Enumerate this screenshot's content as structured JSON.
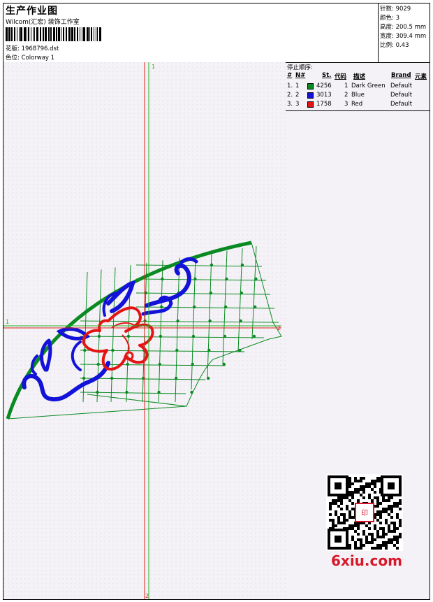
{
  "header": {
    "title": "生产作业图",
    "company": "Wilcom(汇宏) 装饰工作室",
    "design_label": "花版: 1968796.dst",
    "color_label": "色位: Colorway 1"
  },
  "stats": [
    "针数: 9029",
    "颜色: 3",
    "高度: 200.5 mm",
    "宽度: 309.4 mm",
    "比例: 0.43"
  ],
  "stop_sequence": {
    "title": "停止顺序:",
    "columns": [
      "#",
      "N#",
      "St.",
      "代码",
      "描述",
      "Brand",
      "元素"
    ],
    "rows": [
      {
        "idx": "1.",
        "n": "1",
        "stitches": "4256",
        "code": "1",
        "desc": "Dark Green",
        "brand": "Default",
        "color": "#0a8a22"
      },
      {
        "idx": "2.",
        "n": "2",
        "stitches": "3013",
        "code": "2",
        "desc": "Blue",
        "brand": "Default",
        "color": "#1212d8"
      },
      {
        "idx": "3.",
        "n": "3",
        "stitches": "1758",
        "code": "3",
        "desc": "Red",
        "brand": "Default",
        "color": "#e41414"
      }
    ]
  },
  "markers": {
    "v_top": "1",
    "v_bottom": "2",
    "h_left": "1",
    "h_right": "2"
  },
  "watermark": "6xiu.com",
  "colors": {
    "green": "#0a8a22",
    "blue": "#1212d8",
    "red": "#e41414",
    "guide_red": "#e02020",
    "guide_green": "#20b020"
  }
}
